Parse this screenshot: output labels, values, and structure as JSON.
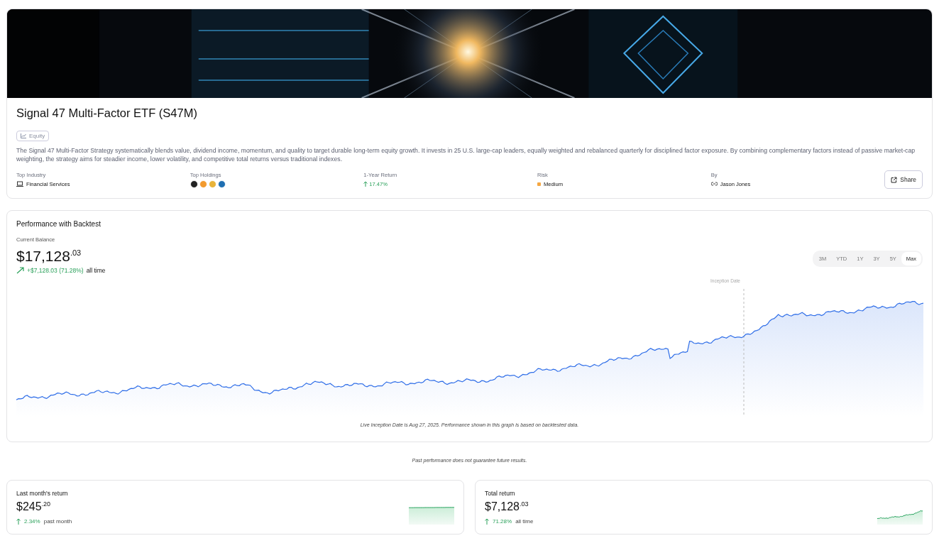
{
  "fund": {
    "title": "Signal 47 Multi-Factor ETF (S47M)",
    "tag": "Equity",
    "description": "The Signal 47 Multi-Factor Strategy systematically blends value, dividend income, momentum, and quality to target durable long-term equity growth. It invests in 25 U.S. large-cap leaders, equally weighted and rebalanced quarterly for disciplined factor exposure. By combining complementary factors instead of passive market-cap weighting, the strategy aims for steadier income, lower volatility, and competitive total returns versus traditional indexes.",
    "stats": [
      {
        "kind": "industry",
        "label": "Top Industry",
        "value": "Financial Services"
      },
      {
        "kind": "holdings",
        "label": "Top Holdings",
        "holdings": [
          {
            "color": "#222222"
          },
          {
            "color": "#f29a2e"
          },
          {
            "color": "#e8b33a"
          },
          {
            "color": "#1f6fb2"
          }
        ]
      },
      {
        "kind": "return",
        "label": "1-Year Return",
        "value": "17.47%"
      },
      {
        "kind": "risk",
        "label": "Risk",
        "value": "Medium",
        "color": "#f5a742"
      },
      {
        "kind": "author",
        "label": "By",
        "value": "Jason Jones"
      }
    ],
    "share_button": "Share"
  },
  "performance": {
    "title": "Performance with Backtest",
    "balance_label": "Current Balance",
    "balance": "$17,128$^{.03}$",
    "change": "+$7,128.03 (71.28%)",
    "change_period": "all time",
    "ranges": [
      {
        "label": "3M",
        "selected": false
      },
      {
        "label": "YTD",
        "selected": false
      },
      {
        "label": "1Y",
        "selected": false
      },
      {
        "label": "3Y",
        "selected": false
      },
      {
        "label": "5Y",
        "selected": false
      },
      {
        "label": "Max",
        "selected": true
      }
    ],
    "inception_label": "Inception Date",
    "note": "Live Inception Date is Aug 27, 2025. Performance shown in this graph is based on backtested data."
  },
  "disclaimer": "Past performance does not guarantee future results.",
  "summary_cards": [
    {
      "title": "Last month's return",
      "amount": "$245$^{.20}$",
      "change": "2.34%",
      "period": "past month"
    },
    {
      "title": "Total return",
      "amount": "$7,128$^{.03}$",
      "change": "71.28%",
      "period": "all time"
    }
  ]
}
